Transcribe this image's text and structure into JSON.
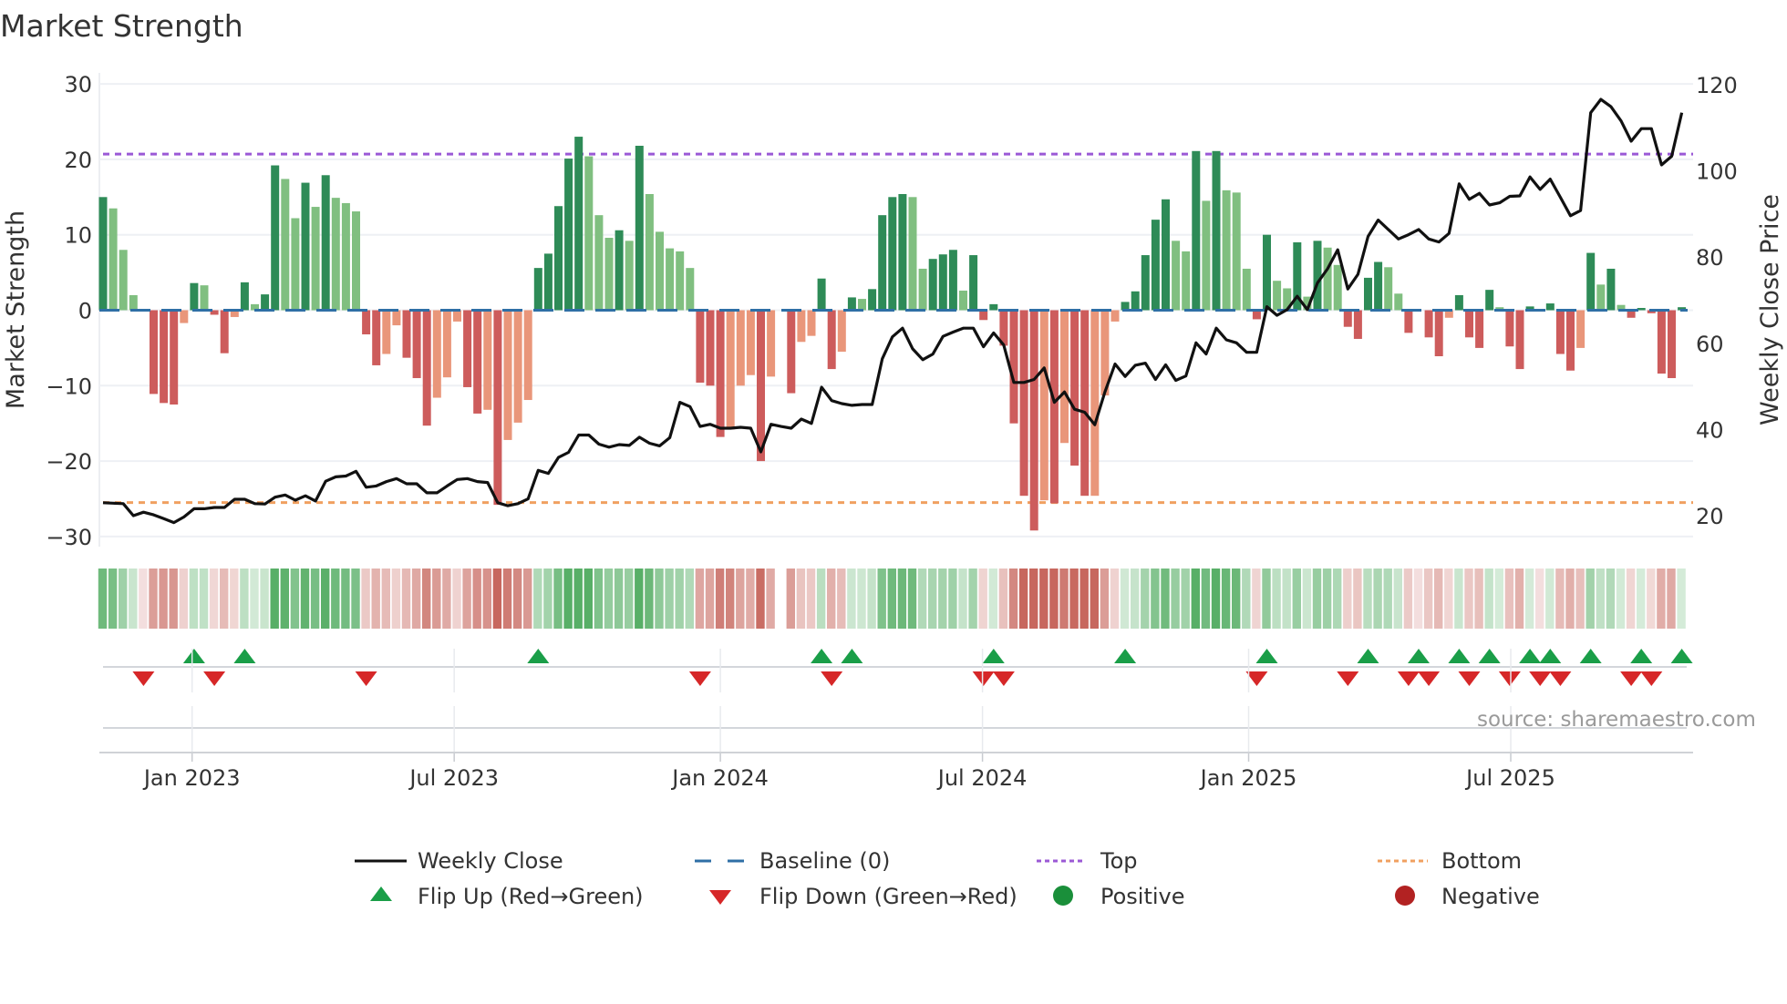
{
  "chart_data": {
    "type": "bar",
    "title": "Market Strength",
    "ylabel": "Market Strength",
    "ylabel_right": "Weekly Close Price",
    "ylim": [
      -31.5,
      31.5
    ],
    "ylim_right": [
      17,
      123
    ],
    "y_ticks": [
      30,
      20,
      10,
      0,
      -10,
      -20,
      -30
    ],
    "y_ticks_right": [
      120,
      100,
      80,
      60,
      40,
      20
    ],
    "x_unit": "week index (weekly bars, first week ~ end Oct 2022)",
    "x_ticks": [
      {
        "label": "Jan 2023",
        "week": 8.8
      },
      {
        "label": "Jul 2023",
        "week": 34.7
      },
      {
        "label": "Jan 2024",
        "week": 61.0
      },
      {
        "label": "Jul 2024",
        "week": 86.9
      },
      {
        "label": "Jan 2025",
        "week": 113.2
      },
      {
        "label": "Jul 2025",
        "week": 139.1
      }
    ],
    "grid": true,
    "top_level": 20.7,
    "bottom_level": -25.5,
    "baseline": 0,
    "strength": [
      15,
      13.5,
      8,
      2,
      0,
      -11.1,
      -12.3,
      -12.5,
      -1.7,
      3.6,
      3.3,
      -0.6,
      -5.7,
      -0.9,
      3.7,
      0.8,
      2.1,
      19.2,
      17.4,
      12.2,
      16.9,
      13.7,
      17.9,
      14.9,
      14.2,
      13.1,
      -3.2,
      -7.3,
      -5.8,
      -2,
      -6.3,
      -9,
      -15.3,
      -11.6,
      -8.9,
      -1.5,
      -10.2,
      -13.7,
      -13.2,
      -25.8,
      -17.2,
      -14.9,
      -11.9,
      5.6,
      7.5,
      13.8,
      20.1,
      23,
      20.4,
      12.6,
      9.6,
      10.6,
      9.2,
      21.8,
      15.4,
      10.4,
      8.2,
      7.8,
      5.6,
      -9.6,
      -10,
      -16.8,
      -15.8,
      -10,
      -8.6,
      -20,
      -8.8,
      0,
      -11,
      -4.2,
      -3.4,
      4.2,
      -7.8,
      -5.5,
      1.7,
      1.5,
      2.8,
      12.6,
      15,
      15.4,
      15,
      5.5,
      6.8,
      7.4,
      8,
      2.6,
      7.3,
      -1.3,
      0.8,
      -4.7,
      -15,
      -24.6,
      -29.2,
      -25.2,
      -25.6,
      -17.6,
      -20.6,
      -24.6,
      -24.6,
      -11.3,
      -1.5,
      1.1,
      2.5,
      7.3,
      12,
      14.7,
      9.2,
      7.8,
      21.1,
      14.5,
      21.1,
      15.9,
      15.6,
      5.5,
      -1.2,
      10,
      3.9,
      2.9,
      9,
      1.8,
      9.2,
      8.3,
      6,
      -2.2,
      -3.8,
      4.3,
      6.4,
      5.7,
      2.2,
      -3,
      0,
      -3.6,
      -6.1,
      -1,
      2,
      -3.6,
      -5,
      2.7,
      0.4,
      -4.8,
      -7.8,
      0.5,
      0,
      0.9,
      -5.8,
      -8,
      -5,
      7.6,
      3.4,
      5.5,
      0.7,
      -1,
      0.3,
      -0.4,
      -8.4,
      -9,
      0.4
    ],
    "shades": "DLLL-RRRODLRRODLDDLLDLDLLLRROORRROOORROROOODDDDDLLLDLDLLLLLRRROOORO-ROODRODLDDDDLLDDDLDRDRRRRORORROOODDDDDLLDLDLLLRDLLDLDLLRRDDLLR-RRODRRDLRRD-DRRODLDLRDRRRD",
    "weekly_close": [
      23.0,
      22.9,
      22.8,
      20.0,
      20.8,
      20.2,
      19.3,
      18.4,
      19.7,
      21.6,
      21.6,
      21.9,
      21.9,
      23.8,
      23.8,
      22.8,
      22.7,
      24.3,
      24.8,
      23.6,
      24.6,
      23.4,
      28.0,
      29.0,
      29.2,
      30.3,
      26.6,
      26.9,
      27.9,
      28.6,
      27.4,
      27.4,
      25.3,
      25.3,
      26.9,
      28.4,
      28.6,
      27.9,
      27.7,
      23.0,
      22.3,
      22.8,
      23.9,
      30.5,
      29.8,
      33.5,
      34.7,
      38.7,
      38.7,
      36.6,
      35.9,
      36.5,
      36.3,
      38.2,
      36.8,
      36.2,
      38.1,
      46.3,
      45.3,
      40.7,
      41.2,
      40.3,
      40.3,
      40.5,
      40.3,
      34.8,
      41.2,
      40.7,
      40.3,
      42.4,
      41.4,
      49.8,
      46.7,
      46.0,
      45.6,
      45.8,
      45.8,
      56.4,
      61.5,
      63.5,
      58.7,
      56.2,
      57.5,
      61.6,
      62.6,
      63.5,
      63.5,
      59.2,
      62.4,
      59.6,
      50.9,
      50.9,
      51.6,
      54.3,
      46.3,
      48.7,
      44.7,
      44.0,
      41.1,
      48.7,
      55.2,
      52.3,
      54.9,
      55.4,
      51.6,
      55.0,
      51.4,
      52.4,
      60.1,
      57.5,
      63.5,
      60.8,
      60.1,
      57.9,
      57.9,
      68.5,
      66.5,
      67.8,
      70.9,
      67.8,
      74.0,
      77.3,
      81.7,
      72.6,
      76.0,
      84.8,
      88.6,
      86.4,
      84.2,
      85.2,
      86.4,
      84.2,
      83.5,
      85.5,
      97.0,
      93.4,
      94.8,
      92.1,
      92.6,
      94.1,
      94.2,
      98.6,
      95.7,
      98.1,
      93.9,
      89.6,
      90.8,
      113.5,
      116.6,
      114.9,
      111.6,
      106.9,
      109.8,
      109.8,
      101.4,
      103.4,
      113.5
    ],
    "flip_up_weeks": [
      9,
      14,
      43,
      71,
      74,
      88,
      101,
      115,
      125,
      130,
      134,
      137,
      141,
      143,
      147,
      152,
      156
    ],
    "flip_down_weeks": [
      4,
      11,
      26,
      59,
      72,
      87,
      89,
      114,
      123,
      129,
      131,
      135,
      139,
      142,
      144,
      151,
      153
    ],
    "legend_placement": "bottom-center",
    "legend": {
      "weekly_close": "Weekly Close",
      "baseline": "Baseline (0)",
      "top": "Top",
      "bottom": "Bottom",
      "flip_up": "Flip Up (Red→Green)",
      "flip_down": "Flip Down (Green→Red)",
      "positive": "Positive",
      "negative": "Negative"
    },
    "source": "source: sharemaestro.com"
  },
  "colors": {
    "dark_green": "#2e8b57",
    "light_green": "#80bf80",
    "red": "#cd5c5c",
    "orange": "#e9967a",
    "line": "#111111",
    "baseline": "#2f6fa6",
    "top": "#9b59d6",
    "bottom": "#f0a060",
    "flip_up": "#1a9e48",
    "flip_down": "#d62728",
    "positive": "#1a8f3a",
    "negative": "#b22222"
  }
}
